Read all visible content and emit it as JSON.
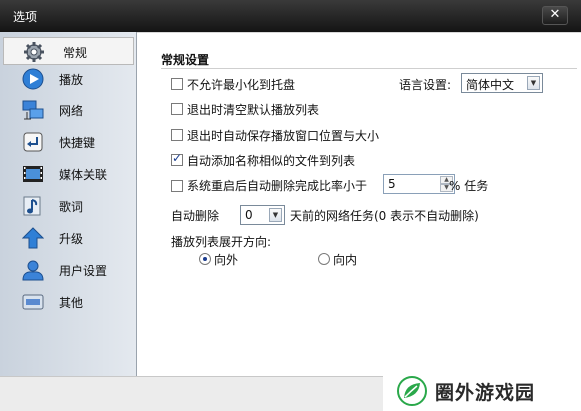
{
  "window": {
    "title": "选项",
    "close_glyph": "✕"
  },
  "sidebar": {
    "items": [
      {
        "label": "常规",
        "icon": "gear-icon",
        "selected": true
      },
      {
        "label": "播放",
        "icon": "play-icon",
        "selected": false
      },
      {
        "label": "网络",
        "icon": "network-icon",
        "selected": false
      },
      {
        "label": "快捷键",
        "icon": "keyboard-enter-icon",
        "selected": false
      },
      {
        "label": "媒体关联",
        "icon": "film-icon",
        "selected": false
      },
      {
        "label": "歌词",
        "icon": "music-note-icon",
        "selected": false
      },
      {
        "label": "升级",
        "icon": "up-arrow-icon",
        "selected": false
      },
      {
        "label": "用户设置",
        "icon": "user-icon",
        "selected": false
      },
      {
        "label": "其他",
        "icon": "misc-icon",
        "selected": false
      }
    ]
  },
  "general": {
    "section_title": "常规设置",
    "options": {
      "minimize_to_tray": {
        "label": "不允许最小化到托盘",
        "checked": false
      },
      "clear_playlist_on_exit": {
        "label": "退出时清空默认播放列表",
        "checked": false
      },
      "save_window_pos": {
        "label": "退出时自动保存播放窗口位置与大小",
        "checked": false
      },
      "add_similar_files": {
        "label": "自动添加名称相似的文件到列表",
        "checked": true
      },
      "auto_delete_completed": {
        "label": "系统重启后自动删除完成比率小于",
        "checked": false
      }
    },
    "language": {
      "label": "语言设置:",
      "value": "简体中文"
    },
    "completion_ratio": {
      "value": "5",
      "suffix": "% 任务"
    },
    "auto_delete": {
      "label": "自动删除",
      "value": "0",
      "suffix": "天前的网络任务(0 表示不自动删除)"
    },
    "playlist_direction": {
      "label": "播放列表展开方向:",
      "options": [
        {
          "label": "向外",
          "checked": true
        },
        {
          "label": "向内",
          "checked": false
        }
      ]
    }
  },
  "watermark": {
    "text": "圈外游戏园"
  },
  "colors": {
    "accent": "#1a3c8e",
    "titlebar": "#1c1c1c",
    "sidebar": "#d5dce5"
  }
}
